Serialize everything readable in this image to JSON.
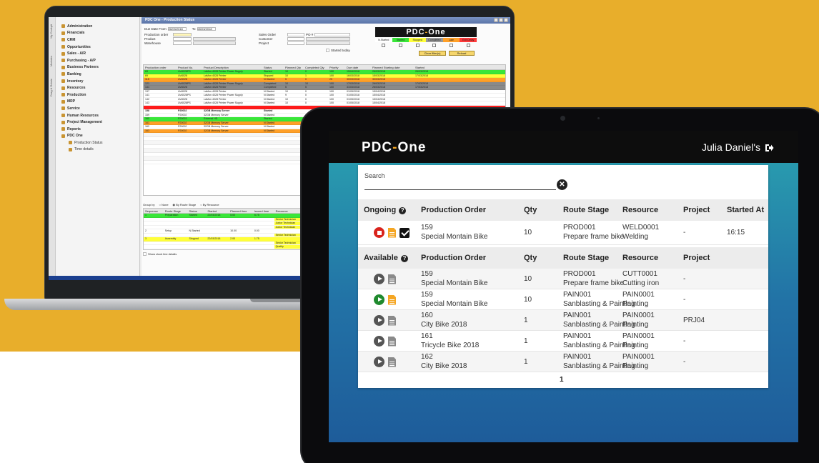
{
  "laptop": {
    "vertical_tabs": [
      "My Cockpit",
      "Modules",
      "Drag & Relate"
    ],
    "menu": [
      {
        "label": "Administration",
        "sub": false
      },
      {
        "label": "Financials",
        "sub": false
      },
      {
        "label": "CRM",
        "sub": false
      },
      {
        "label": "Opportunities",
        "sub": false
      },
      {
        "label": "Sales - A/R",
        "sub": false
      },
      {
        "label": "Purchasing - A/P",
        "sub": false
      },
      {
        "label": "Business Partners",
        "sub": false
      },
      {
        "label": "Banking",
        "sub": false
      },
      {
        "label": "Inventory",
        "sub": false
      },
      {
        "label": "Resources",
        "sub": false
      },
      {
        "label": "Production",
        "sub": false
      },
      {
        "label": "MRP",
        "sub": false
      },
      {
        "label": "Service",
        "sub": false
      },
      {
        "label": "Human Resources",
        "sub": false
      },
      {
        "label": "Project Management",
        "sub": false
      },
      {
        "label": "Reports",
        "sub": false
      },
      {
        "label": "PDC One",
        "sub": false
      },
      {
        "label": "Production Status",
        "sub": true
      },
      {
        "label": "Time details",
        "sub": true
      }
    ],
    "window_title": "PDC One - Production Status",
    "filters": {
      "due_date_label": "Due Date From",
      "from_value": "26/03/2018",
      "to_label": "To",
      "to_value": "26/03/2018",
      "production_order_label": "Production order",
      "product_label": "Product",
      "warehouse_label": "Warehouse",
      "sales_order_label": "Sales Order",
      "po_label": "PO #",
      "customer_label": "Customer",
      "project_label": "Project",
      "started_today_label": "Started today"
    },
    "legend": [
      "N.Started",
      "Started",
      "Stopped",
      "Completed",
      "Late",
      "Exit Delay"
    ],
    "buttons": {
      "clear_filters": "Clear filter(s)",
      "reload": "Reload"
    },
    "grid_headers": [
      "Production order",
      "Product No.",
      "Product Description",
      "Status",
      "Planned Qty",
      "Completed Qty",
      "Priority",
      "Due date",
      "Planned Starting date",
      "Started"
    ],
    "grid_rows": [
      {
        "po": "63",
        "pn": "LM4028PS",
        "desc": "LaMon 4028 Printer Power Supply",
        "status": "Started",
        "pq": "10",
        "cq": "0",
        "pr": "100",
        "due": "15/04/2018",
        "psd": "26/03/2018",
        "st": "26/03/2018",
        "color": "#39e639"
      },
      {
        "po": "69",
        "pn": "LM4028",
        "desc": "LaMon 4028 Printer",
        "status": "Stopped",
        "pq": "10",
        "cq": "1",
        "pr": "100",
        "due": "16/03/2018",
        "psd": "15/03/2018",
        "st": "17/03/2018",
        "color": "#ffff3a"
      },
      {
        "po": "115",
        "pn": "LM4028",
        "desc": "LaMon 4028 Printer",
        "status": "N.Started",
        "pq": "5",
        "cq": "0",
        "pr": "25",
        "due": "30/03/2018",
        "psd": "30/03/2018",
        "st": "",
        "color": "#ffa028"
      },
      {
        "po": "121",
        "pn": "LM4028PS",
        "desc": "LaMon 4028 Printer Power Supply",
        "status": "Completed",
        "pq": "10",
        "cq": "10",
        "pr": "100",
        "due": "17/03/2018",
        "psd": "26/03/2018",
        "st": "17/03/2018",
        "color": "#8a8a8a"
      },
      {
        "po": "131",
        "pn": "LM4028",
        "desc": "LaMon 4028 Printer",
        "status": "Completed",
        "pq": "5",
        "cq": "5",
        "pr": "100",
        "due": "31/03/2018",
        "psd": "26/03/2018",
        "st": "17/03/2018",
        "color": "#8a8a8a"
      },
      {
        "po": "137",
        "pn": "LM4028",
        "desc": "LaMon 4028 Printer",
        "status": "N.Started",
        "pq": "10",
        "cq": "0",
        "pr": "100",
        "due": "01/05/2018",
        "psd": "15/04/2018",
        "st": "",
        "color": "#ffffff"
      },
      {
        "po": "141",
        "pn": "LM4028PS",
        "desc": "LaMon 4028 Printer Power Supply",
        "status": "N.Started",
        "pq": "9",
        "cq": "0",
        "pr": "100",
        "due": "01/05/2018",
        "psd": "15/04/2018",
        "st": "",
        "color": "#ffffff"
      },
      {
        "po": "142",
        "pn": "LM4028",
        "desc": "LaMon 4028 Printer",
        "status": "N.Started",
        "pq": "10",
        "cq": "0",
        "pr": "100",
        "due": "01/05/2018",
        "psd": "15/04/2018",
        "st": "",
        "color": "#ffffff"
      },
      {
        "po": "143",
        "pn": "LM4028PS",
        "desc": "LaMon 4028 Printer Power Supply",
        "status": "N.Started",
        "pq": "10",
        "cq": "0",
        "pr": "100",
        "due": "01/05/2018",
        "psd": "15/04/2018",
        "st": "",
        "color": "#ffffff"
      },
      {
        "po": "",
        "pn": "",
        "desc": "",
        "status": "",
        "pq": "",
        "cq": "",
        "pr": "",
        "due": "",
        "psd": "",
        "st": "",
        "color": "#ff1a1a"
      },
      {
        "po": "158",
        "pn": "P20002",
        "desc": "32GB Memory Server",
        "status": "Started",
        "pq": "",
        "cq": "",
        "pr": "",
        "due": "",
        "psd": "",
        "st": "",
        "color": "#ffffff",
        "bold": true
      },
      {
        "po": "159",
        "pn": "P20002",
        "desc": "32GB Memory Server",
        "status": "N.Started",
        "pq": "",
        "cq": "",
        "pr": "",
        "due": "",
        "psd": "",
        "st": "",
        "color": "#ffffff"
      },
      {
        "po": "160",
        "pn": "P20003",
        "desc": "External HD",
        "status": "Started",
        "pq": "",
        "cq": "",
        "pr": "",
        "due": "",
        "psd": "",
        "st": "",
        "color": "#39e639"
      },
      {
        "po": "161",
        "pn": "P20002",
        "desc": "32GB Memory Server",
        "status": "N.Started",
        "pq": "",
        "cq": "",
        "pr": "",
        "due": "",
        "psd": "",
        "st": "",
        "color": "#ffa028"
      },
      {
        "po": "162",
        "pn": "P20002",
        "desc": "32GB Memory Server",
        "status": "N.Started",
        "pq": "",
        "cq": "",
        "pr": "",
        "due": "",
        "psd": "",
        "st": "",
        "color": "#ffffff"
      },
      {
        "po": "163",
        "pn": "P20002",
        "desc": "32GB Memory Server",
        "status": "N.Started",
        "pq": "",
        "cq": "",
        "pr": "",
        "due": "",
        "psd": "",
        "st": "",
        "color": "#ffa028"
      }
    ],
    "groupby": {
      "label": "Group by",
      "opt_none": "None",
      "opt_route": "By Route Stage",
      "opt_resource": "By Resource"
    },
    "sub_headers": [
      "Sequence",
      "Route Stage",
      "Status",
      "Started",
      "Planned time",
      "Issued time",
      "Resource"
    ],
    "sub_rows": [
      {
        "seq": "1",
        "stage": "Preparation",
        "status": "Started",
        "started": "22/03/2018",
        "pt": "5.00",
        "it": "6.75",
        "res": "",
        "color": "#39e639"
      },
      {
        "seq": "",
        "stage": "",
        "status": "",
        "started": "",
        "pt": "",
        "it": "",
        "res": "Senior Technician",
        "color": "#ffffff"
      },
      {
        "seq": "",
        "stage": "",
        "status": "",
        "started": "",
        "pt": "",
        "it": "",
        "res": "Junior Technician",
        "color": "#ffffff"
      },
      {
        "seq": "",
        "stage": "",
        "status": "",
        "started": "",
        "pt": "",
        "it": "",
        "res": "Junior Technician",
        "color": "#ffffff"
      },
      {
        "seq": "2",
        "stage": "Setup",
        "status": "N.Started",
        "started": "",
        "pt": "10.00",
        "it": "0.00",
        "res": "",
        "color": "#ffffff"
      },
      {
        "seq": "",
        "stage": "",
        "status": "",
        "started": "",
        "pt": "",
        "it": "",
        "res": "Senior Technician",
        "color": "#ffffff"
      },
      {
        "seq": "3",
        "stage": "Assembly",
        "status": "Stopped",
        "started": "22/03/2018",
        "pt": "2.00",
        "it": "1.75",
        "res": "",
        "color": "#ffff3a"
      },
      {
        "seq": "",
        "stage": "",
        "status": "",
        "started": "",
        "pt": "",
        "it": "",
        "res": "Senior Technician",
        "color": "#ffffff"
      },
      {
        "seq": "",
        "stage": "",
        "status": "",
        "started": "",
        "pt": "",
        "it": "",
        "res": "Quality",
        "color": "#ffffff"
      }
    ],
    "show_clock": "Show clock line details"
  },
  "app": {
    "logo_text": "PDC",
    "logo_dash": "-",
    "logo_tail": "One",
    "user": "Julia Daniel's",
    "search": {
      "label": "Search",
      "value": ""
    },
    "ongoing": {
      "label": "Ongoing",
      "headers": {
        "po": "Production Order",
        "qty": "Qty",
        "route": "Route Stage",
        "resource": "Resource",
        "project": "Project",
        "started": "Started At"
      },
      "rows": [
        {
          "po_id": "159",
          "po_name": "Special Montain Bike",
          "qty": "10",
          "route_id": "PROD001",
          "route_name": "Prepare frame bike",
          "res_id": "WELD0001",
          "res_name": "Welding",
          "project": "-",
          "started": "16:15"
        }
      ]
    },
    "available": {
      "label": "Available",
      "headers": {
        "po": "Production Order",
        "qty": "Qty",
        "route": "Route Stage",
        "resource": "Resource",
        "project": "Project"
      },
      "rows": [
        {
          "po_id": "159",
          "po_name": "Special Montain Bike",
          "qty": "10",
          "route_id": "PROD001",
          "route_name": "Prepare frame bike",
          "res_id": "CUTT0001",
          "res_name": "Cutting iron",
          "project": "-",
          "highlight": false
        },
        {
          "po_id": "159",
          "po_name": "Special Montain Bike",
          "qty": "10",
          "route_id": "PAIN001",
          "route_name": "Sanblasting & Painting",
          "res_id": "PAIN0001",
          "res_name": "Painting",
          "project": "-",
          "highlight": true
        },
        {
          "po_id": "160",
          "po_name": "City Bike 2018",
          "qty": "1",
          "route_id": "PAIN001",
          "route_name": "Sanblasting & Painting",
          "res_id": "PAIN0001",
          "res_name": "Painting",
          "project": "PRJ04",
          "highlight": false
        },
        {
          "po_id": "161",
          "po_name": "Tricycle Bike 2018",
          "qty": "1",
          "route_id": "PAIN001",
          "route_name": "Sanblasting & Painting",
          "res_id": "PAIN0001",
          "res_name": "Painting",
          "project": "-",
          "highlight": false
        },
        {
          "po_id": "162",
          "po_name": "City Bike 2018",
          "qty": "1",
          "route_id": "PAIN001",
          "route_name": "Sanblasting & Painting",
          "res_id": "PAIN0001",
          "res_name": "Painting",
          "project": "-",
          "highlight": false
        }
      ]
    },
    "pager": "1"
  },
  "colors": {
    "brand_orange": "#f5a623",
    "background": "#e8ae2b",
    "stop_red": "#d9231c",
    "play_green": "#1f8a2e"
  }
}
